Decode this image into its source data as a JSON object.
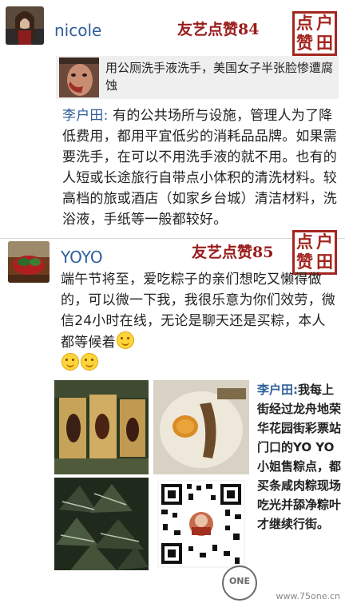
{
  "posts": [
    {
      "username": "nicole",
      "likes": "友艺点赞84",
      "stamp": [
        "点",
        "户",
        "赞",
        "田"
      ],
      "shared_article": {
        "title": "用公厕洗手液洗手，美国女子半张脸惨遭腐蚀"
      },
      "comment": {
        "author": "李户田:",
        "text": "有的公共场所与设施，管理人为了降低费用，都用平宜低劣的消耗品品牌。如果需要洗手，在可以不用洗手液的就不用。也有的人短或长途旅行自带点小体积的清洗材料。较高档的旅或酒店（如家乡台城）清洁材料，洗浴液，手纸等一般都较好。"
      }
    },
    {
      "username": "YOYO",
      "likes": "友艺点赞85",
      "stamp": [
        "点",
        "户",
        "赞",
        "田"
      ],
      "text": "端午节将至，爱吃粽子的亲们想吃又懒得做的，可以微一下我，我很乐意为你们效劳，微信24小时在线，无论是聊天还是买粽，本人都等候着",
      "side_comment": {
        "author": "李户田:",
        "text": "我每上街经过龙舟地荣华花园街彩票站门口的YO YO 小姐售粽点，都买条咸肉粽现场吃光并舔净粽叶才继续行街。"
      }
    }
  ],
  "watermark": "www.75one.cn",
  "logo_text": "ONE",
  "colors": {
    "username": "#2f5f9a",
    "likes": "#9b1c1c",
    "stamp": "#a3261f"
  }
}
